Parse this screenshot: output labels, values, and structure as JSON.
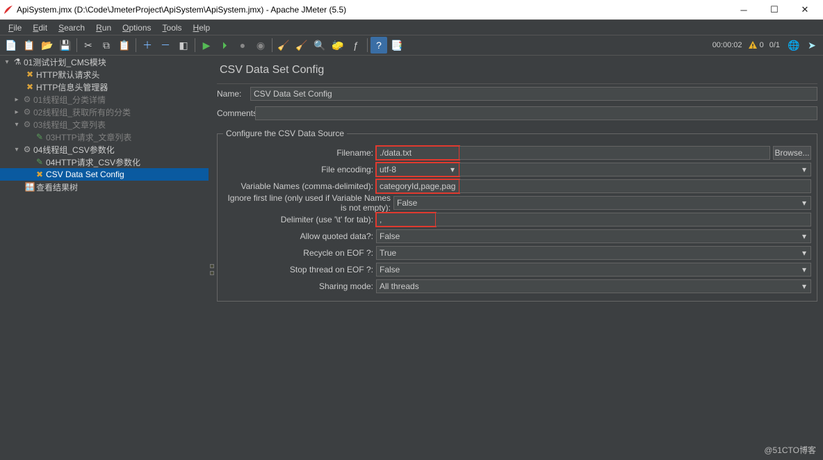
{
  "title": "ApiSystem.jmx (D:\\Code\\JmeterProject\\ApiSystem\\ApiSystem.jmx) - Apache JMeter (5.5)",
  "menu": {
    "items": [
      "File",
      "Edit",
      "Search",
      "Run",
      "Options",
      "Tools",
      "Help"
    ]
  },
  "statusbar": {
    "elapsed": "00:00:02",
    "warn_count": "0",
    "threads": "0/1"
  },
  "tree": {
    "root": "01测试计划_CMS模块",
    "n1": "HTTP默认请求头",
    "n2": "HTTP信息头管理器",
    "n3": "01线程组_分类详情",
    "n4": "02线程组_获取所有的分类",
    "n5": "03线程组_文章列表",
    "n5a": "03HTTP请求_文章列表",
    "n6": "04线程组_CSV参数化",
    "n6a": "04HTTP请求_CSV参数化",
    "n6b": "CSV Data Set Config",
    "n7": "查看结果树"
  },
  "panel": {
    "title": "CSV Data Set Config",
    "name_label": "Name:",
    "name_value": "CSV Data Set Config",
    "comments_label": "Comments:",
    "comments_value": "",
    "group_legend": "Configure the CSV Data Source",
    "rows": {
      "filename": {
        "label": "Filename:",
        "value": "./data.txt",
        "browse": "Browse..."
      },
      "encoding": {
        "label": "File encoding:",
        "value": "utf-8"
      },
      "varnames": {
        "label": "Variable Names (comma-delimited):",
        "value": "categoryId,page,pageSize"
      },
      "ignorefirst": {
        "label": "Ignore first line (only used if Variable Names is not empty):",
        "value": "False"
      },
      "delimiter": {
        "label": "Delimiter (use '\\t' for tab):",
        "value": ","
      },
      "quoted": {
        "label": "Allow quoted data?:",
        "value": "False"
      },
      "recycle": {
        "label": "Recycle on EOF ?:",
        "value": "True"
      },
      "stopthread": {
        "label": "Stop thread on EOF ?:",
        "value": "False"
      },
      "sharing": {
        "label": "Sharing mode:",
        "value": "All threads"
      }
    }
  },
  "watermark": "@51CTO博客"
}
